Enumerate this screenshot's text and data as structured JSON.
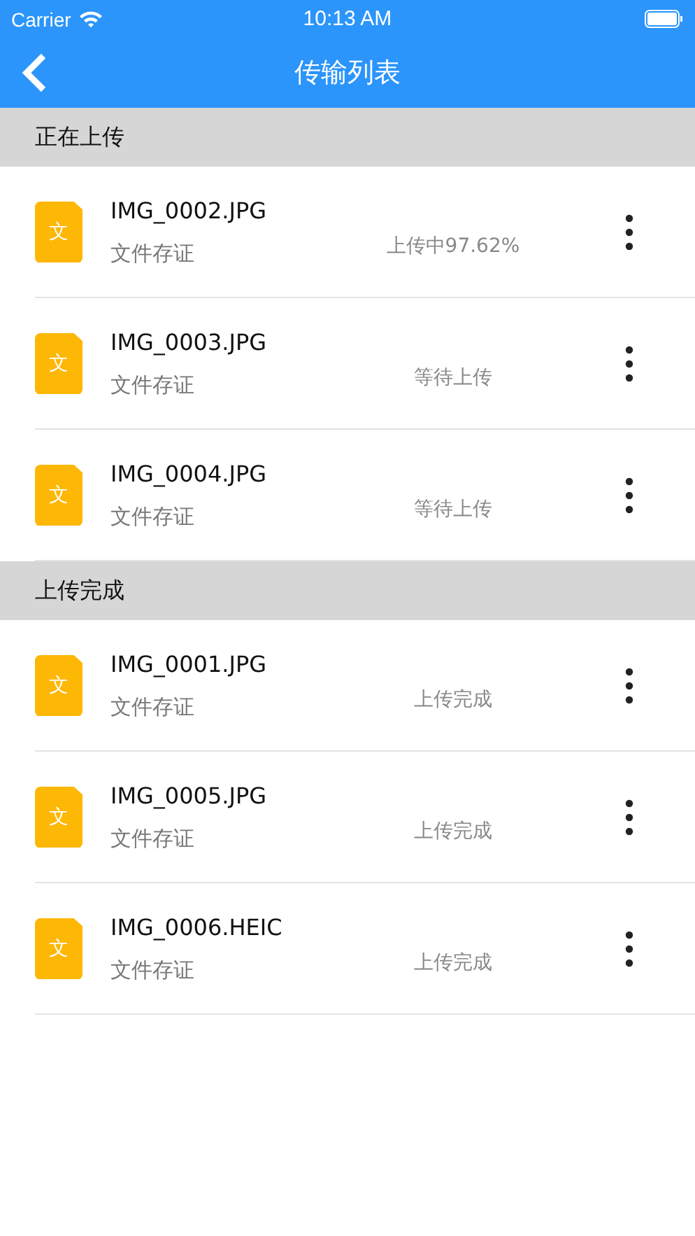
{
  "status_bar": {
    "carrier": "Carrier",
    "time": "10:13 AM"
  },
  "nav": {
    "title": "传输列表"
  },
  "sections": [
    {
      "title": "正在上传",
      "items": [
        {
          "icon_text": "文",
          "name": "IMG_0002.JPG",
          "subtitle": "文件存证",
          "status": "上传中97.62%"
        },
        {
          "icon_text": "文",
          "name": "IMG_0003.JPG",
          "subtitle": "文件存证",
          "status": "等待上传"
        },
        {
          "icon_text": "文",
          "name": "IMG_0004.JPG",
          "subtitle": "文件存证",
          "status": "等待上传"
        }
      ]
    },
    {
      "title": "上传完成",
      "items": [
        {
          "icon_text": "文",
          "name": "IMG_0001.JPG",
          "subtitle": "文件存证",
          "status": "上传完成"
        },
        {
          "icon_text": "文",
          "name": "IMG_0005.JPG",
          "subtitle": "文件存证",
          "status": "上传完成"
        },
        {
          "icon_text": "文",
          "name": "IMG_0006.HEIC",
          "subtitle": "文件存证",
          "status": "上传完成"
        }
      ]
    }
  ]
}
